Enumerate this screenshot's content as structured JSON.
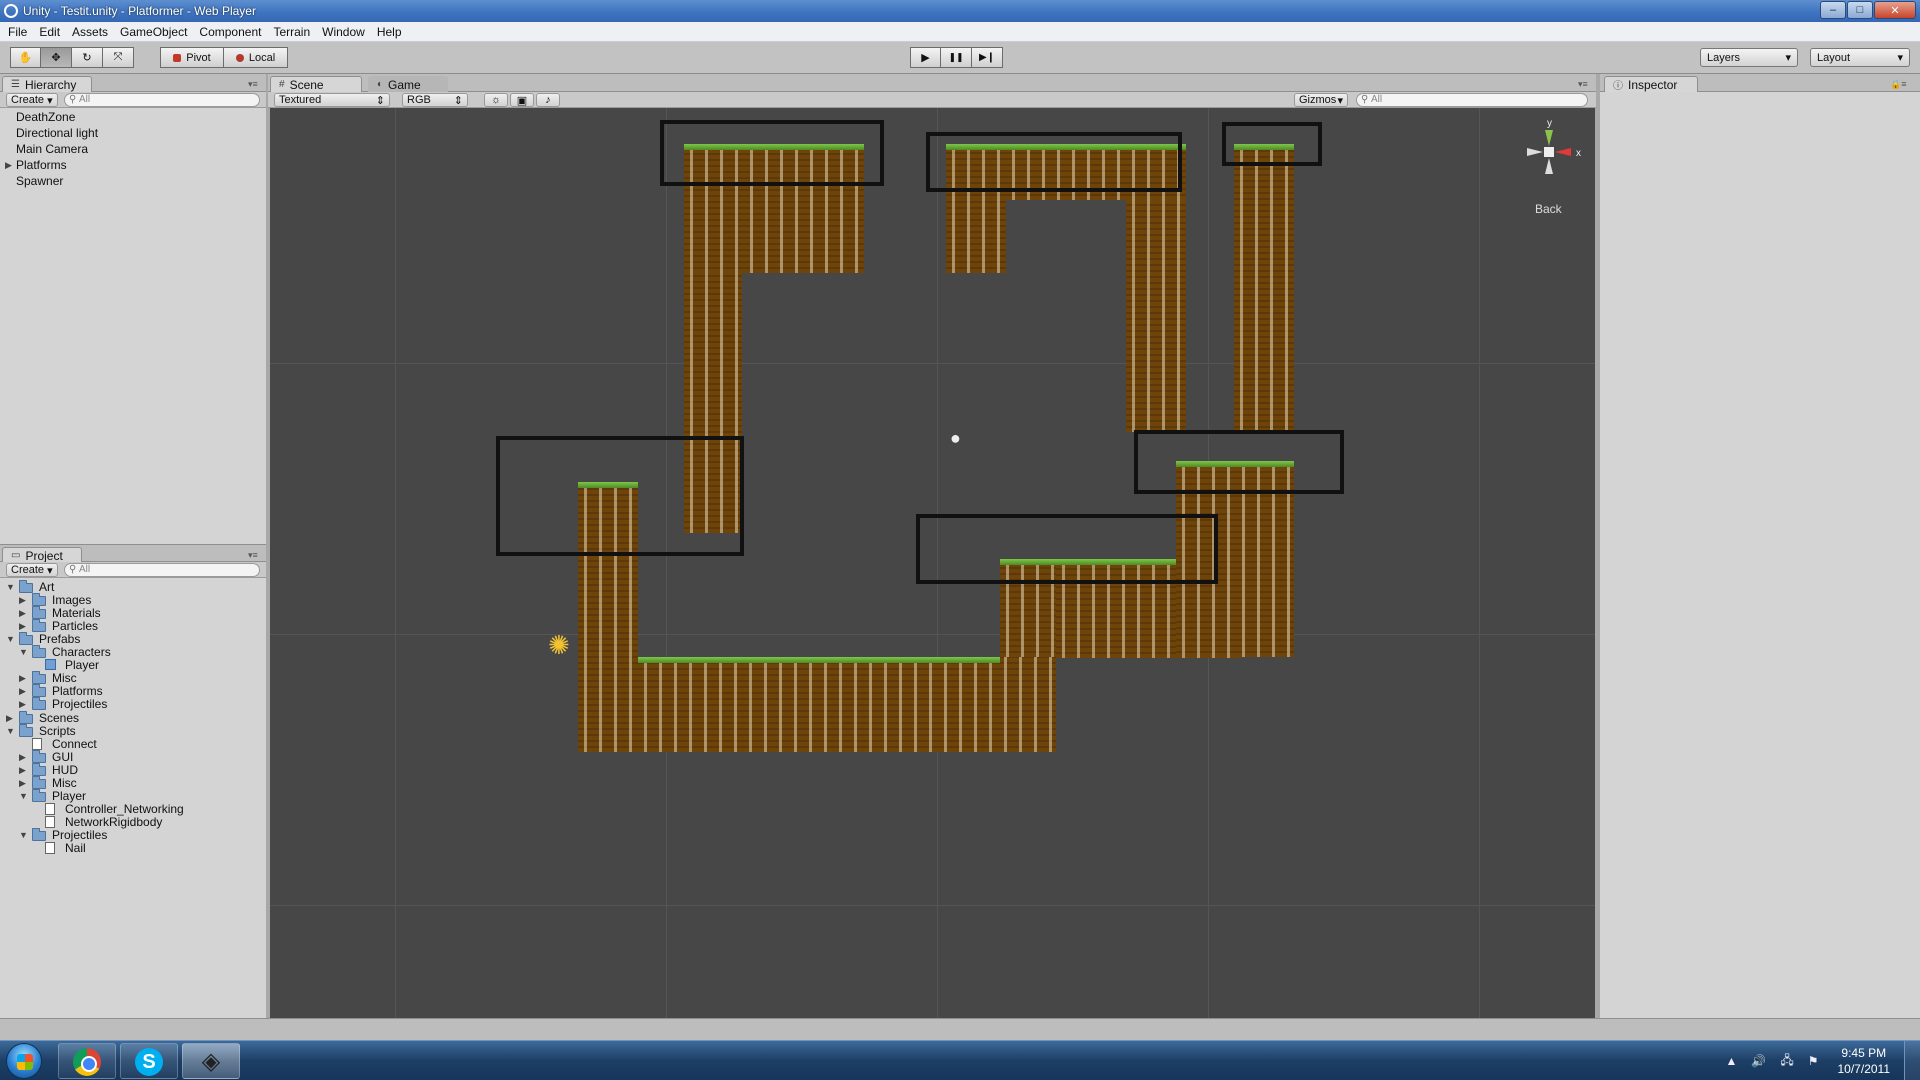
{
  "window": {
    "title": "Unity - Testit.unity - Platformer - Web Player",
    "minimize": "–",
    "maximize": "□",
    "close": "✕"
  },
  "menu": [
    "File",
    "Edit",
    "Assets",
    "GameObject",
    "Component",
    "Terrain",
    "Window",
    "Help"
  ],
  "toolbar": {
    "transform_tools": [
      {
        "name": "hand-tool",
        "icon": "hand-icon",
        "glyph": "✋",
        "active": false
      },
      {
        "name": "move-tool",
        "icon": "move-icon",
        "glyph": "✥",
        "active": true
      },
      {
        "name": "rotate-tool",
        "icon": "rotate-icon",
        "glyph": "↻",
        "active": false
      },
      {
        "name": "scale-tool",
        "icon": "scale-icon",
        "glyph": "⤧",
        "active": false
      }
    ],
    "pivot_label": "Pivot",
    "local_label": "Local",
    "play_glyph": "▶",
    "pause_glyph": "❚❚",
    "step_glyph": "▶❙",
    "layers_label": "Layers",
    "layout_label": "Layout"
  },
  "hierarchy": {
    "tab": "Hierarchy",
    "create": "Create",
    "search_placeholder": "All",
    "items": [
      {
        "label": "DeathZone",
        "has_children": false
      },
      {
        "label": "Directional light",
        "has_children": false
      },
      {
        "label": "Main Camera",
        "has_children": false
      },
      {
        "label": "Platforms",
        "has_children": true
      },
      {
        "label": "Spawner",
        "has_children": false
      }
    ]
  },
  "project": {
    "tab": "Project",
    "create": "Create",
    "search_placeholder": "All",
    "items": [
      {
        "label": "Art",
        "depth": 0,
        "type": "folder",
        "expanded": true
      },
      {
        "label": "Images",
        "depth": 1,
        "type": "folder",
        "expanded": false
      },
      {
        "label": "Materials",
        "depth": 1,
        "type": "folder",
        "expanded": false
      },
      {
        "label": "Particles",
        "depth": 1,
        "type": "folder",
        "expanded": false
      },
      {
        "label": "Prefabs",
        "depth": 0,
        "type": "folder",
        "expanded": true
      },
      {
        "label": "Characters",
        "depth": 1,
        "type": "folder",
        "expanded": true
      },
      {
        "label": "Player",
        "depth": 2,
        "type": "prefab",
        "expanded": false
      },
      {
        "label": "Misc",
        "depth": 1,
        "type": "folder",
        "expanded": false
      },
      {
        "label": "Platforms",
        "depth": 1,
        "type": "folder",
        "expanded": false
      },
      {
        "label": "Projectiles",
        "depth": 1,
        "type": "folder",
        "expanded": false
      },
      {
        "label": "Scenes",
        "depth": 0,
        "type": "folder",
        "expanded": false
      },
      {
        "label": "Scripts",
        "depth": 0,
        "type": "folder",
        "expanded": true
      },
      {
        "label": "Connect",
        "depth": 1,
        "type": "script",
        "expanded": null
      },
      {
        "label": "GUI",
        "depth": 1,
        "type": "folder",
        "expanded": false
      },
      {
        "label": "HUD",
        "depth": 1,
        "type": "folder",
        "expanded": false
      },
      {
        "label": "Misc",
        "depth": 1,
        "type": "folder",
        "expanded": false
      },
      {
        "label": "Player",
        "depth": 1,
        "type": "folder",
        "expanded": true
      },
      {
        "label": "Controller_Networking",
        "depth": 2,
        "type": "script",
        "expanded": null
      },
      {
        "label": "NetworkRigidbody",
        "depth": 2,
        "type": "script",
        "expanded": null
      },
      {
        "label": "Projectiles",
        "depth": 1,
        "type": "folder",
        "expanded": true
      },
      {
        "label": "Nail",
        "depth": 2,
        "type": "script",
        "expanded": null
      }
    ]
  },
  "scene": {
    "tab_scene": "Scene",
    "tab_game": "Game",
    "render_mode": "Textured",
    "color_mode": "RGB",
    "gizmos_label": "Gizmos",
    "search_placeholder": "All",
    "gizmo_view_label": "Back",
    "axis_y": "y",
    "axis_x": "x",
    "colors": {
      "background": "#474747",
      "dirt": "#6e4408",
      "grass": "#6cb63c",
      "selection": "#111111"
    }
  },
  "inspector": {
    "tab": "Inspector"
  },
  "taskbar": {
    "time": "9:45 PM",
    "date": "10/7/2011",
    "apps": [
      {
        "name": "chrome",
        "icon": "chrome-icon"
      },
      {
        "name": "skype",
        "icon": "skype-icon",
        "glyph": "S"
      },
      {
        "name": "unity",
        "icon": "unity-icon",
        "glyph": "◈"
      }
    ],
    "tray_glyphs": [
      "▲",
      "🔊",
      "🖧",
      "⚑"
    ]
  }
}
